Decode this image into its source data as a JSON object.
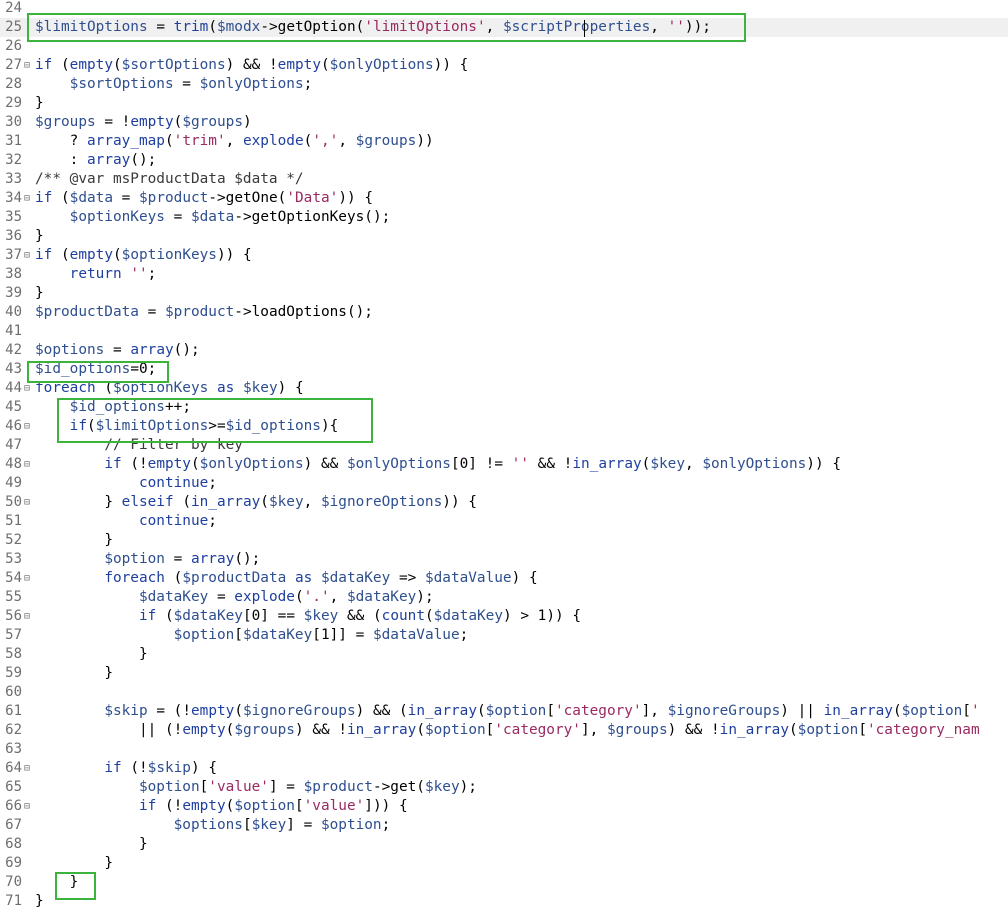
{
  "editor": {
    "highlight_color": "#3cb43c",
    "current_line_color": "#f0f0f0",
    "lines": [
      {
        "num": "24",
        "fold": "",
        "text": ""
      },
      {
        "num": "25",
        "fold": "",
        "text": "$limitOptions = trim($modx->getOption('limitOptions', $scriptProperties, ''));",
        "current": true
      },
      {
        "num": "26",
        "fold": "",
        "text": ""
      },
      {
        "num": "27",
        "fold": "⊟",
        "text": "if (empty($sortOptions) && !empty($onlyOptions)) {"
      },
      {
        "num": "28",
        "fold": "",
        "text": "    $sortOptions = $onlyOptions;"
      },
      {
        "num": "29",
        "fold": "",
        "text": "}"
      },
      {
        "num": "30",
        "fold": "",
        "text": "$groups = !empty($groups)"
      },
      {
        "num": "31",
        "fold": "",
        "text": "    ? array_map('trim', explode(',', $groups))"
      },
      {
        "num": "32",
        "fold": "",
        "text": "    : array();"
      },
      {
        "num": "33",
        "fold": "",
        "text": "/** @var msProductData $data */"
      },
      {
        "num": "34",
        "fold": "⊟",
        "text": "if ($data = $product->getOne('Data')) {"
      },
      {
        "num": "35",
        "fold": "",
        "text": "    $optionKeys = $data->getOptionKeys();"
      },
      {
        "num": "36",
        "fold": "",
        "text": "}"
      },
      {
        "num": "37",
        "fold": "⊟",
        "text": "if (empty($optionKeys)) {"
      },
      {
        "num": "38",
        "fold": "",
        "text": "    return '';"
      },
      {
        "num": "39",
        "fold": "",
        "text": "}"
      },
      {
        "num": "40",
        "fold": "",
        "text": "$productData = $product->loadOptions();"
      },
      {
        "num": "41",
        "fold": "",
        "text": ""
      },
      {
        "num": "42",
        "fold": "",
        "text": "$options = array();"
      },
      {
        "num": "43",
        "fold": "",
        "text": "$id_options=0;"
      },
      {
        "num": "44",
        "fold": "⊟",
        "text": "foreach ($optionKeys as $key) {"
      },
      {
        "num": "45",
        "fold": "",
        "text": "    $id_options++;"
      },
      {
        "num": "46",
        "fold": "⊟",
        "text": "    if($limitOptions>=$id_options){"
      },
      {
        "num": "47",
        "fold": "",
        "text": "        // Filter by key"
      },
      {
        "num": "48",
        "fold": "⊟",
        "text": "        if (!empty($onlyOptions) && $onlyOptions[0] != '' && !in_array($key, $onlyOptions)) {"
      },
      {
        "num": "49",
        "fold": "",
        "text": "            continue;"
      },
      {
        "num": "50",
        "fold": "⊟",
        "text": "        } elseif (in_array($key, $ignoreOptions)) {"
      },
      {
        "num": "51",
        "fold": "",
        "text": "            continue;"
      },
      {
        "num": "52",
        "fold": "",
        "text": "        }"
      },
      {
        "num": "53",
        "fold": "",
        "text": "        $option = array();"
      },
      {
        "num": "54",
        "fold": "⊟",
        "text": "        foreach ($productData as $dataKey => $dataValue) {"
      },
      {
        "num": "55",
        "fold": "",
        "text": "            $dataKey = explode('.', $dataKey);"
      },
      {
        "num": "56",
        "fold": "⊟",
        "text": "            if ($dataKey[0] == $key && (count($dataKey) > 1)) {"
      },
      {
        "num": "57",
        "fold": "",
        "text": "                $option[$dataKey[1]] = $dataValue;"
      },
      {
        "num": "58",
        "fold": "",
        "text": "            }"
      },
      {
        "num": "59",
        "fold": "",
        "text": "        }"
      },
      {
        "num": "60",
        "fold": "",
        "text": ""
      },
      {
        "num": "61",
        "fold": "",
        "text": "        $skip = (!empty($ignoreGroups) && (in_array($option['category'], $ignoreGroups) || in_array($option['"
      },
      {
        "num": "62",
        "fold": "",
        "text": "            || (!empty($groups) && !in_array($option['category'], $groups) && !in_array($option['category_nam"
      },
      {
        "num": "63",
        "fold": "",
        "text": ""
      },
      {
        "num": "64",
        "fold": "⊟",
        "text": "        if (!$skip) {"
      },
      {
        "num": "65",
        "fold": "",
        "text": "            $option['value'] = $product->get($key);"
      },
      {
        "num": "66",
        "fold": "⊟",
        "text": "            if (!empty($option['value'])) {"
      },
      {
        "num": "67",
        "fold": "",
        "text": "                $options[$key] = $option;"
      },
      {
        "num": "68",
        "fold": "",
        "text": "            }"
      },
      {
        "num": "69",
        "fold": "",
        "text": "        }"
      },
      {
        "num": "70",
        "fold": "",
        "text": "    }"
      },
      {
        "num": "71",
        "fold": "",
        "text": "}"
      }
    ]
  }
}
